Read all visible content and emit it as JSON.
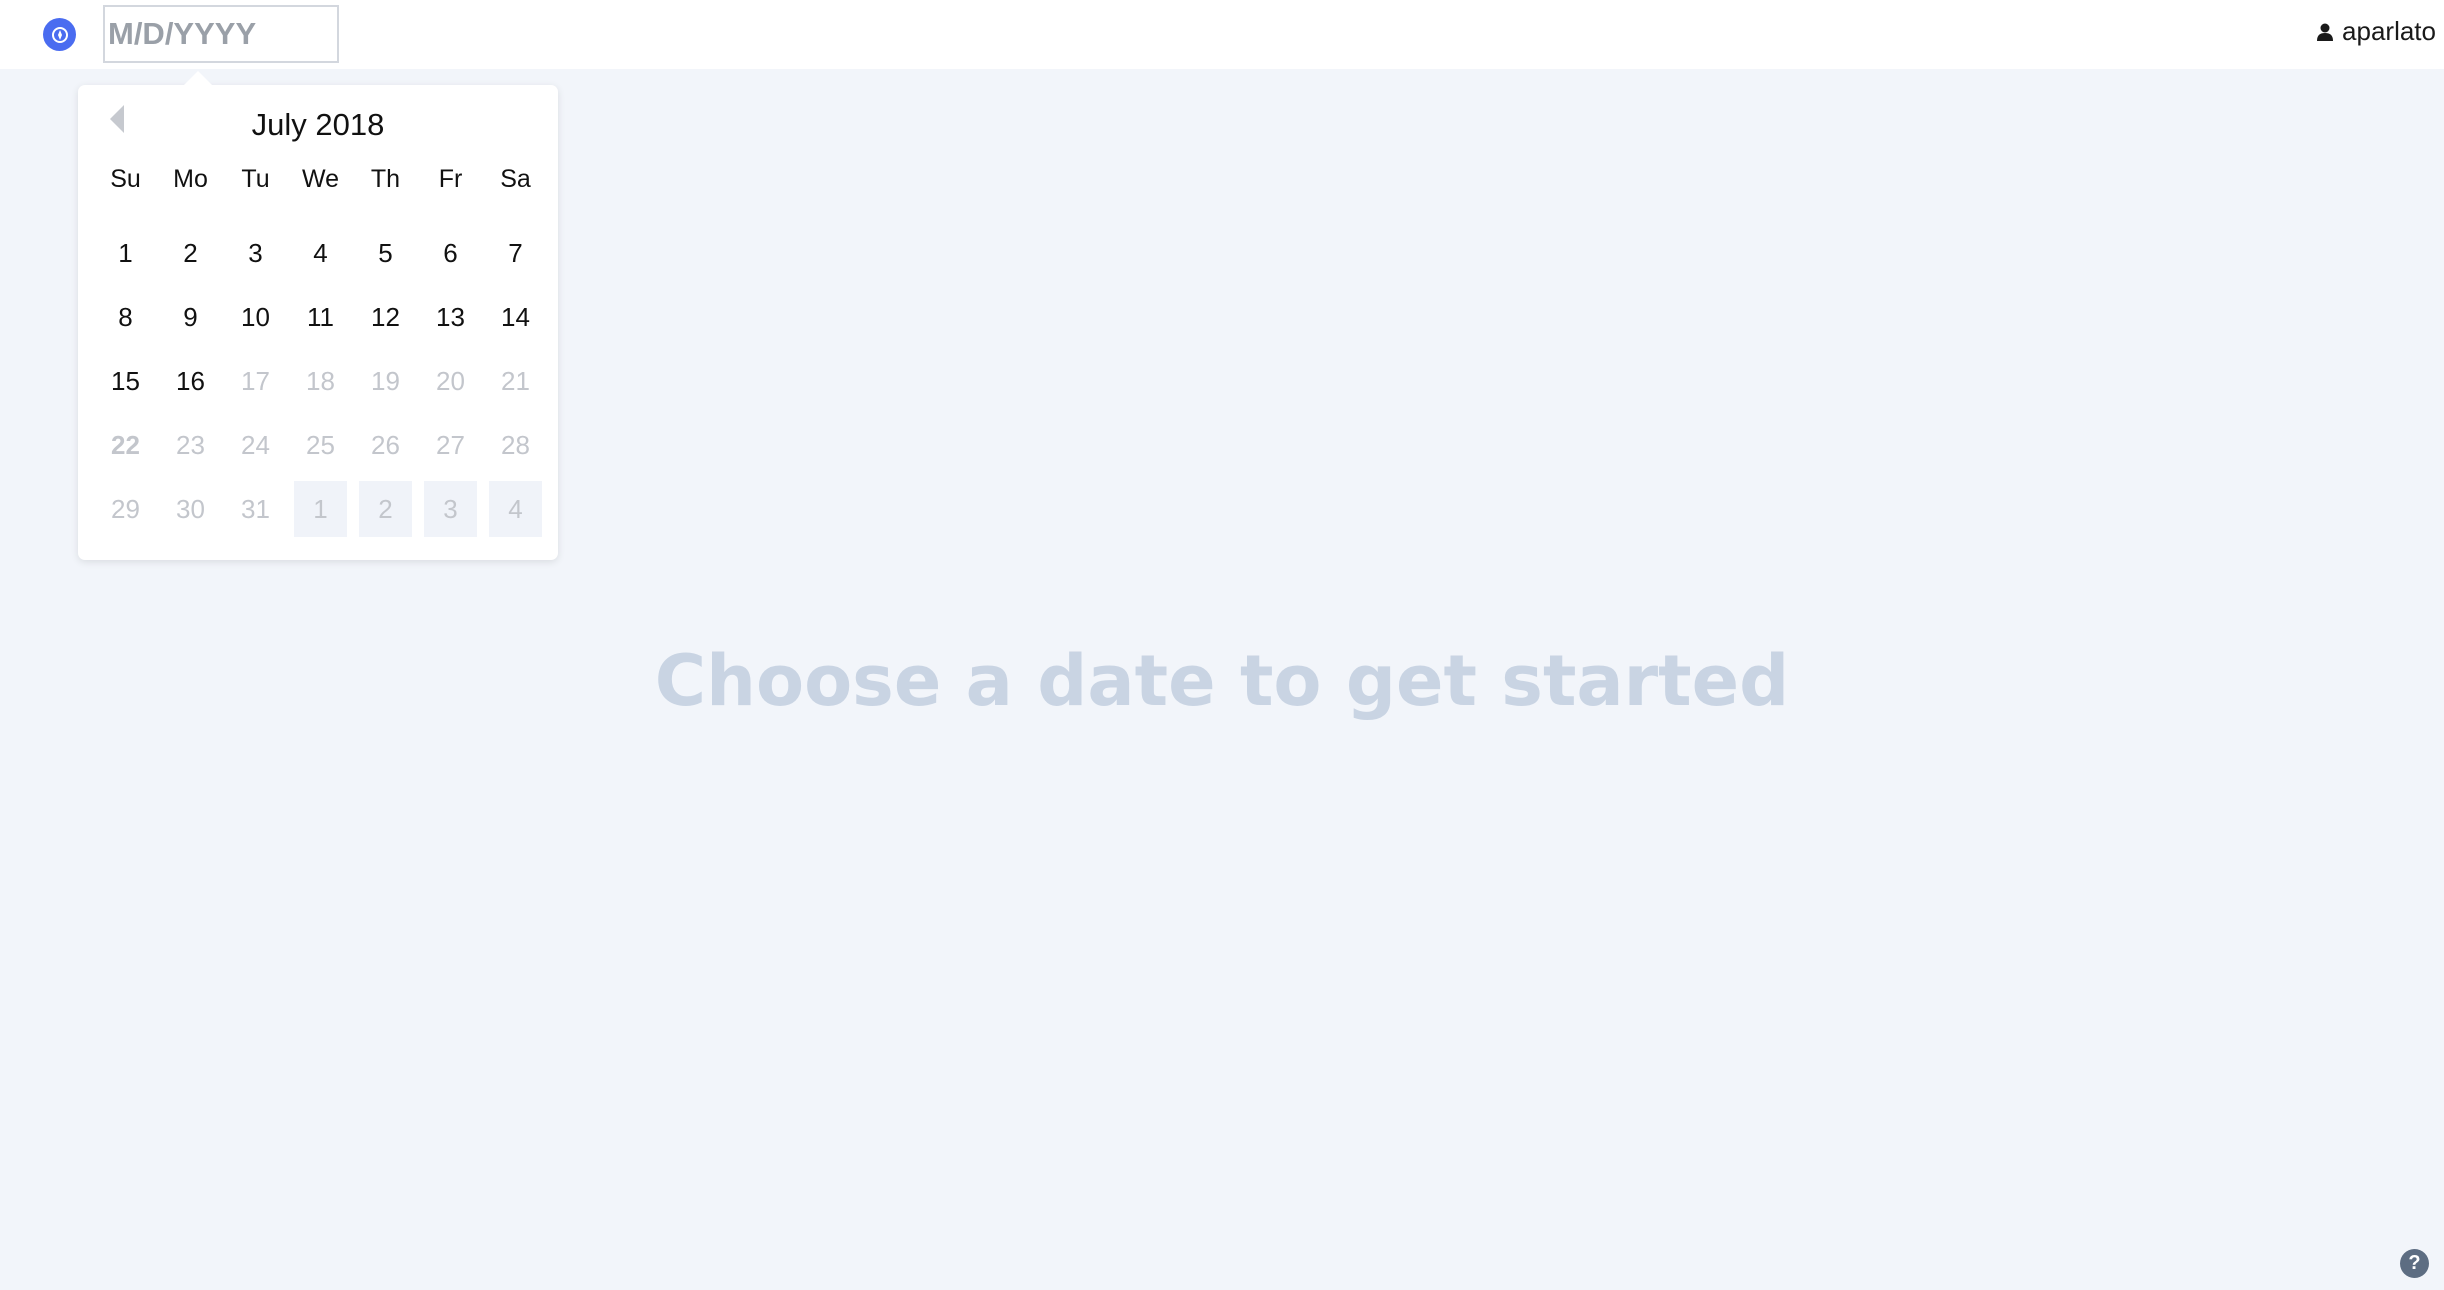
{
  "header": {
    "logo_icon": "compass-icon",
    "date_input": {
      "value": "",
      "placeholder": "M/D/YYYY"
    },
    "user": {
      "icon": "person-icon",
      "name": "aparlato"
    }
  },
  "calendar": {
    "prev_icon": "chevron-left-icon",
    "month_label": "July 2018",
    "weekdays": [
      "Su",
      "Mo",
      "Tu",
      "We",
      "Th",
      "Fr",
      "Sa"
    ],
    "weeks": [
      [
        {
          "d": "1"
        },
        {
          "d": "2"
        },
        {
          "d": "3"
        },
        {
          "d": "4"
        },
        {
          "d": "5"
        },
        {
          "d": "6"
        },
        {
          "d": "7"
        }
      ],
      [
        {
          "d": "8"
        },
        {
          "d": "9"
        },
        {
          "d": "10"
        },
        {
          "d": "11"
        },
        {
          "d": "12"
        },
        {
          "d": "13"
        },
        {
          "d": "14"
        }
      ],
      [
        {
          "d": "15"
        },
        {
          "d": "16"
        },
        {
          "d": "17",
          "disabled": true
        },
        {
          "d": "18",
          "disabled": true
        },
        {
          "d": "19",
          "disabled": true
        },
        {
          "d": "20",
          "disabled": true
        },
        {
          "d": "21",
          "disabled": true
        }
      ],
      [
        {
          "d": "22",
          "disabled": true,
          "today": true
        },
        {
          "d": "23",
          "disabled": true
        },
        {
          "d": "24",
          "disabled": true
        },
        {
          "d": "25",
          "disabled": true
        },
        {
          "d": "26",
          "disabled": true
        },
        {
          "d": "27",
          "disabled": true
        },
        {
          "d": "28",
          "disabled": true
        }
      ],
      [
        {
          "d": "29",
          "disabled": true
        },
        {
          "d": "30",
          "disabled": true
        },
        {
          "d": "31",
          "disabled": true
        },
        {
          "d": "1",
          "disabled": true,
          "outside": true
        },
        {
          "d": "2",
          "disabled": true,
          "outside": true
        },
        {
          "d": "3",
          "disabled": true,
          "outside": true
        },
        {
          "d": "4",
          "disabled": true,
          "outside": true
        }
      ]
    ]
  },
  "main": {
    "prompt": "Choose a date to get started"
  },
  "help": {
    "icon": "question-icon",
    "label": "?"
  },
  "colors": {
    "accent": "#4a6cf0",
    "background": "#f2f5fa",
    "prompt_text": "#c9d4e3",
    "disabled_day": "#c3c6cc"
  }
}
